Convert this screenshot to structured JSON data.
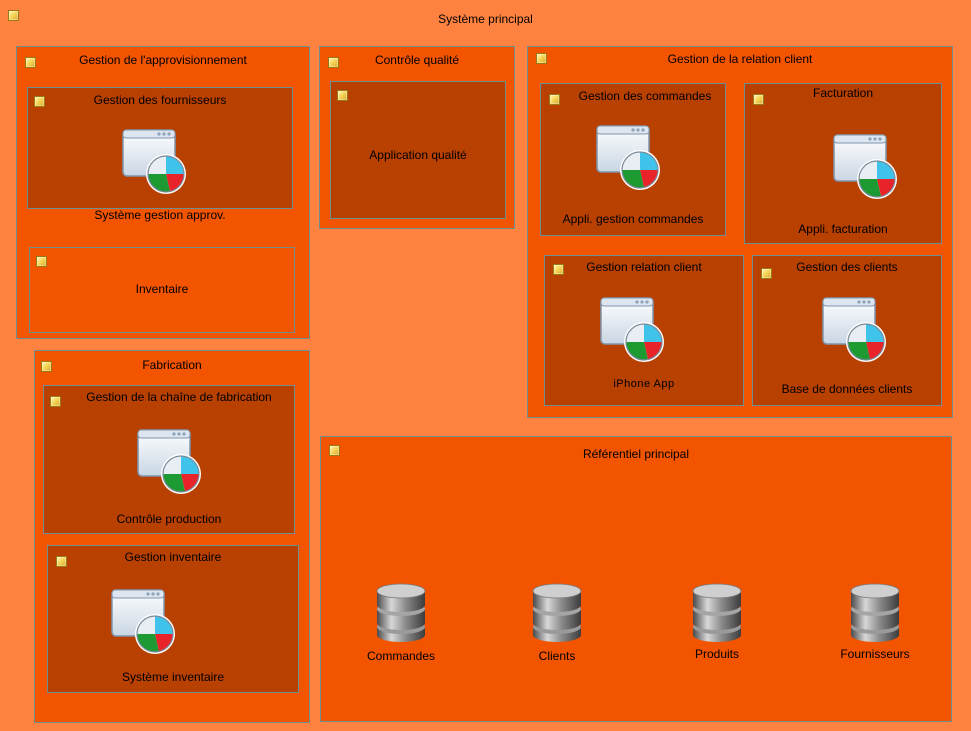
{
  "root": {
    "title": "Système principal"
  },
  "groups": {
    "approvisionnement": {
      "title": "Gestion de l'approvisionnement",
      "fournisseurs": {
        "title": "Gestion des fournisseurs",
        "app": "Système gestion approv."
      },
      "inventaire": {
        "title": "Inventaire"
      }
    },
    "qualite": {
      "title": "Contrôle qualité",
      "application": {
        "title": "Application qualité"
      }
    },
    "relation_client": {
      "title": "Gestion de la relation client",
      "commandes": {
        "title": "Gestion des commandes",
        "app": "Appli. gestion commandes"
      },
      "facturation": {
        "title": "Facturation",
        "app": "Appli. facturation"
      },
      "crm": {
        "title": "Gestion relation client",
        "app": "iPhone App"
      },
      "clients": {
        "title": "Gestion des clients",
        "app": "Base de données clients"
      }
    },
    "fabrication": {
      "title": "Fabrication",
      "chaine": {
        "title": "Gestion de la chaîne de fabrication",
        "app": "Contrôle production"
      },
      "inventaire": {
        "title": "Gestion inventaire",
        "app": "Système inventaire"
      }
    },
    "referentiel": {
      "title": "Référentiel principal",
      "databases": [
        "Commandes",
        "Clients",
        "Produits",
        "Fournisseurs"
      ]
    }
  },
  "icons": {
    "group_marker": "checkbox-icon",
    "application": "application-chart-icon",
    "database": "database-icon"
  },
  "colors": {
    "background": "#ff8240",
    "group": "#f25400",
    "subgroup": "#b84000",
    "border": "#6f8f8f"
  }
}
